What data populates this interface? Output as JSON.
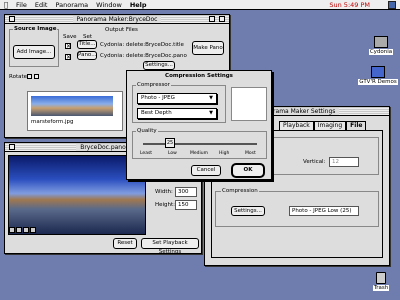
{
  "menubar": {
    "items": [
      "File",
      "Edit",
      "Panorama",
      "Window",
      "Help"
    ],
    "clock": "Sun 5:49 PM"
  },
  "desktop": {
    "icons": [
      {
        "label": "Cydonia",
        "icon": "disk-icon"
      },
      {
        "label": "GTV'R Demos",
        "icon": "folder-icon"
      },
      {
        "label": "Trash",
        "icon": "trash-icon"
      }
    ]
  },
  "main_window": {
    "title": "Panorama Maker:BryceDoc",
    "source_group_title": "Source Image",
    "add_image_button": "Add Image...",
    "output_title": "Output Files",
    "col_save": "Save",
    "col_set": "Set",
    "title_button": "Title...",
    "title_path": "Cydonia: delete:BryceDoc.title",
    "pano_button": "Pano...",
    "pano_path": "Cydonia: delete:BryceDoc.pano",
    "settings_button": "Settings...",
    "make_pano_button": "Make Pano",
    "rotate_label": "Rotate:",
    "thumb_name": "marsteform.jpg"
  },
  "preview_window": {
    "title": "BryceDoc.pano",
    "width_label": "Width:",
    "width_value": "300",
    "height_label": "Height:",
    "height_value": "150",
    "reset_button": "Reset",
    "playback_button": "Set Playback Settings"
  },
  "settings_window": {
    "title": "Panorama Maker Settings",
    "tabs": [
      "Playback",
      "Imaging",
      "File"
    ],
    "vertical_label": "Vertical:",
    "vertical_value": "12",
    "compression_label": "Compression",
    "settings_button": "Settings...",
    "compression_value": "Photo - JPEG Low (25)"
  },
  "compression_dialog": {
    "title": "Compression Settings",
    "compressor_label": "Compressor",
    "compressor_value": "Photo - JPEG",
    "depth_value": "Best Depth",
    "quality_label": "Quality",
    "quality_value": "25",
    "quality_level": 0.25,
    "quality_ticks": [
      "Least",
      "Low",
      "Medium",
      "High",
      "Most"
    ],
    "cancel_button": "Cancel",
    "ok_button": "OK"
  }
}
